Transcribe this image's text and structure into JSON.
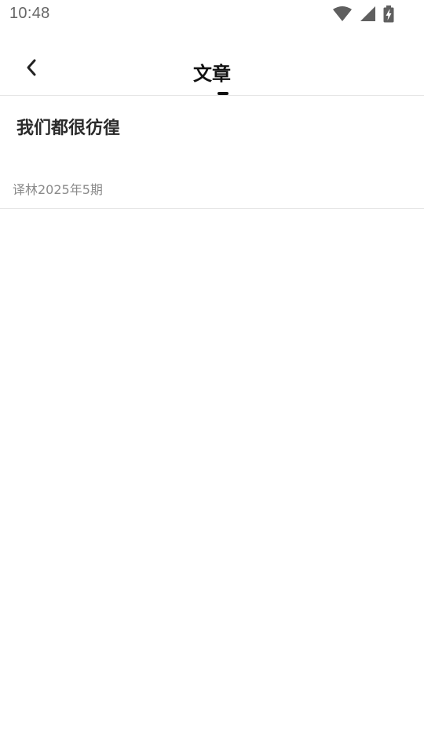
{
  "status_bar": {
    "time": "10:48",
    "icons": [
      "wifi-icon",
      "signal-icon",
      "battery-charging-icon"
    ]
  },
  "toolbar": {
    "back_icon": "chevron-left-icon",
    "title": "文章"
  },
  "articles": [
    {
      "title": "我们都很彷徨",
      "source": "译林2025年5期"
    }
  ]
}
